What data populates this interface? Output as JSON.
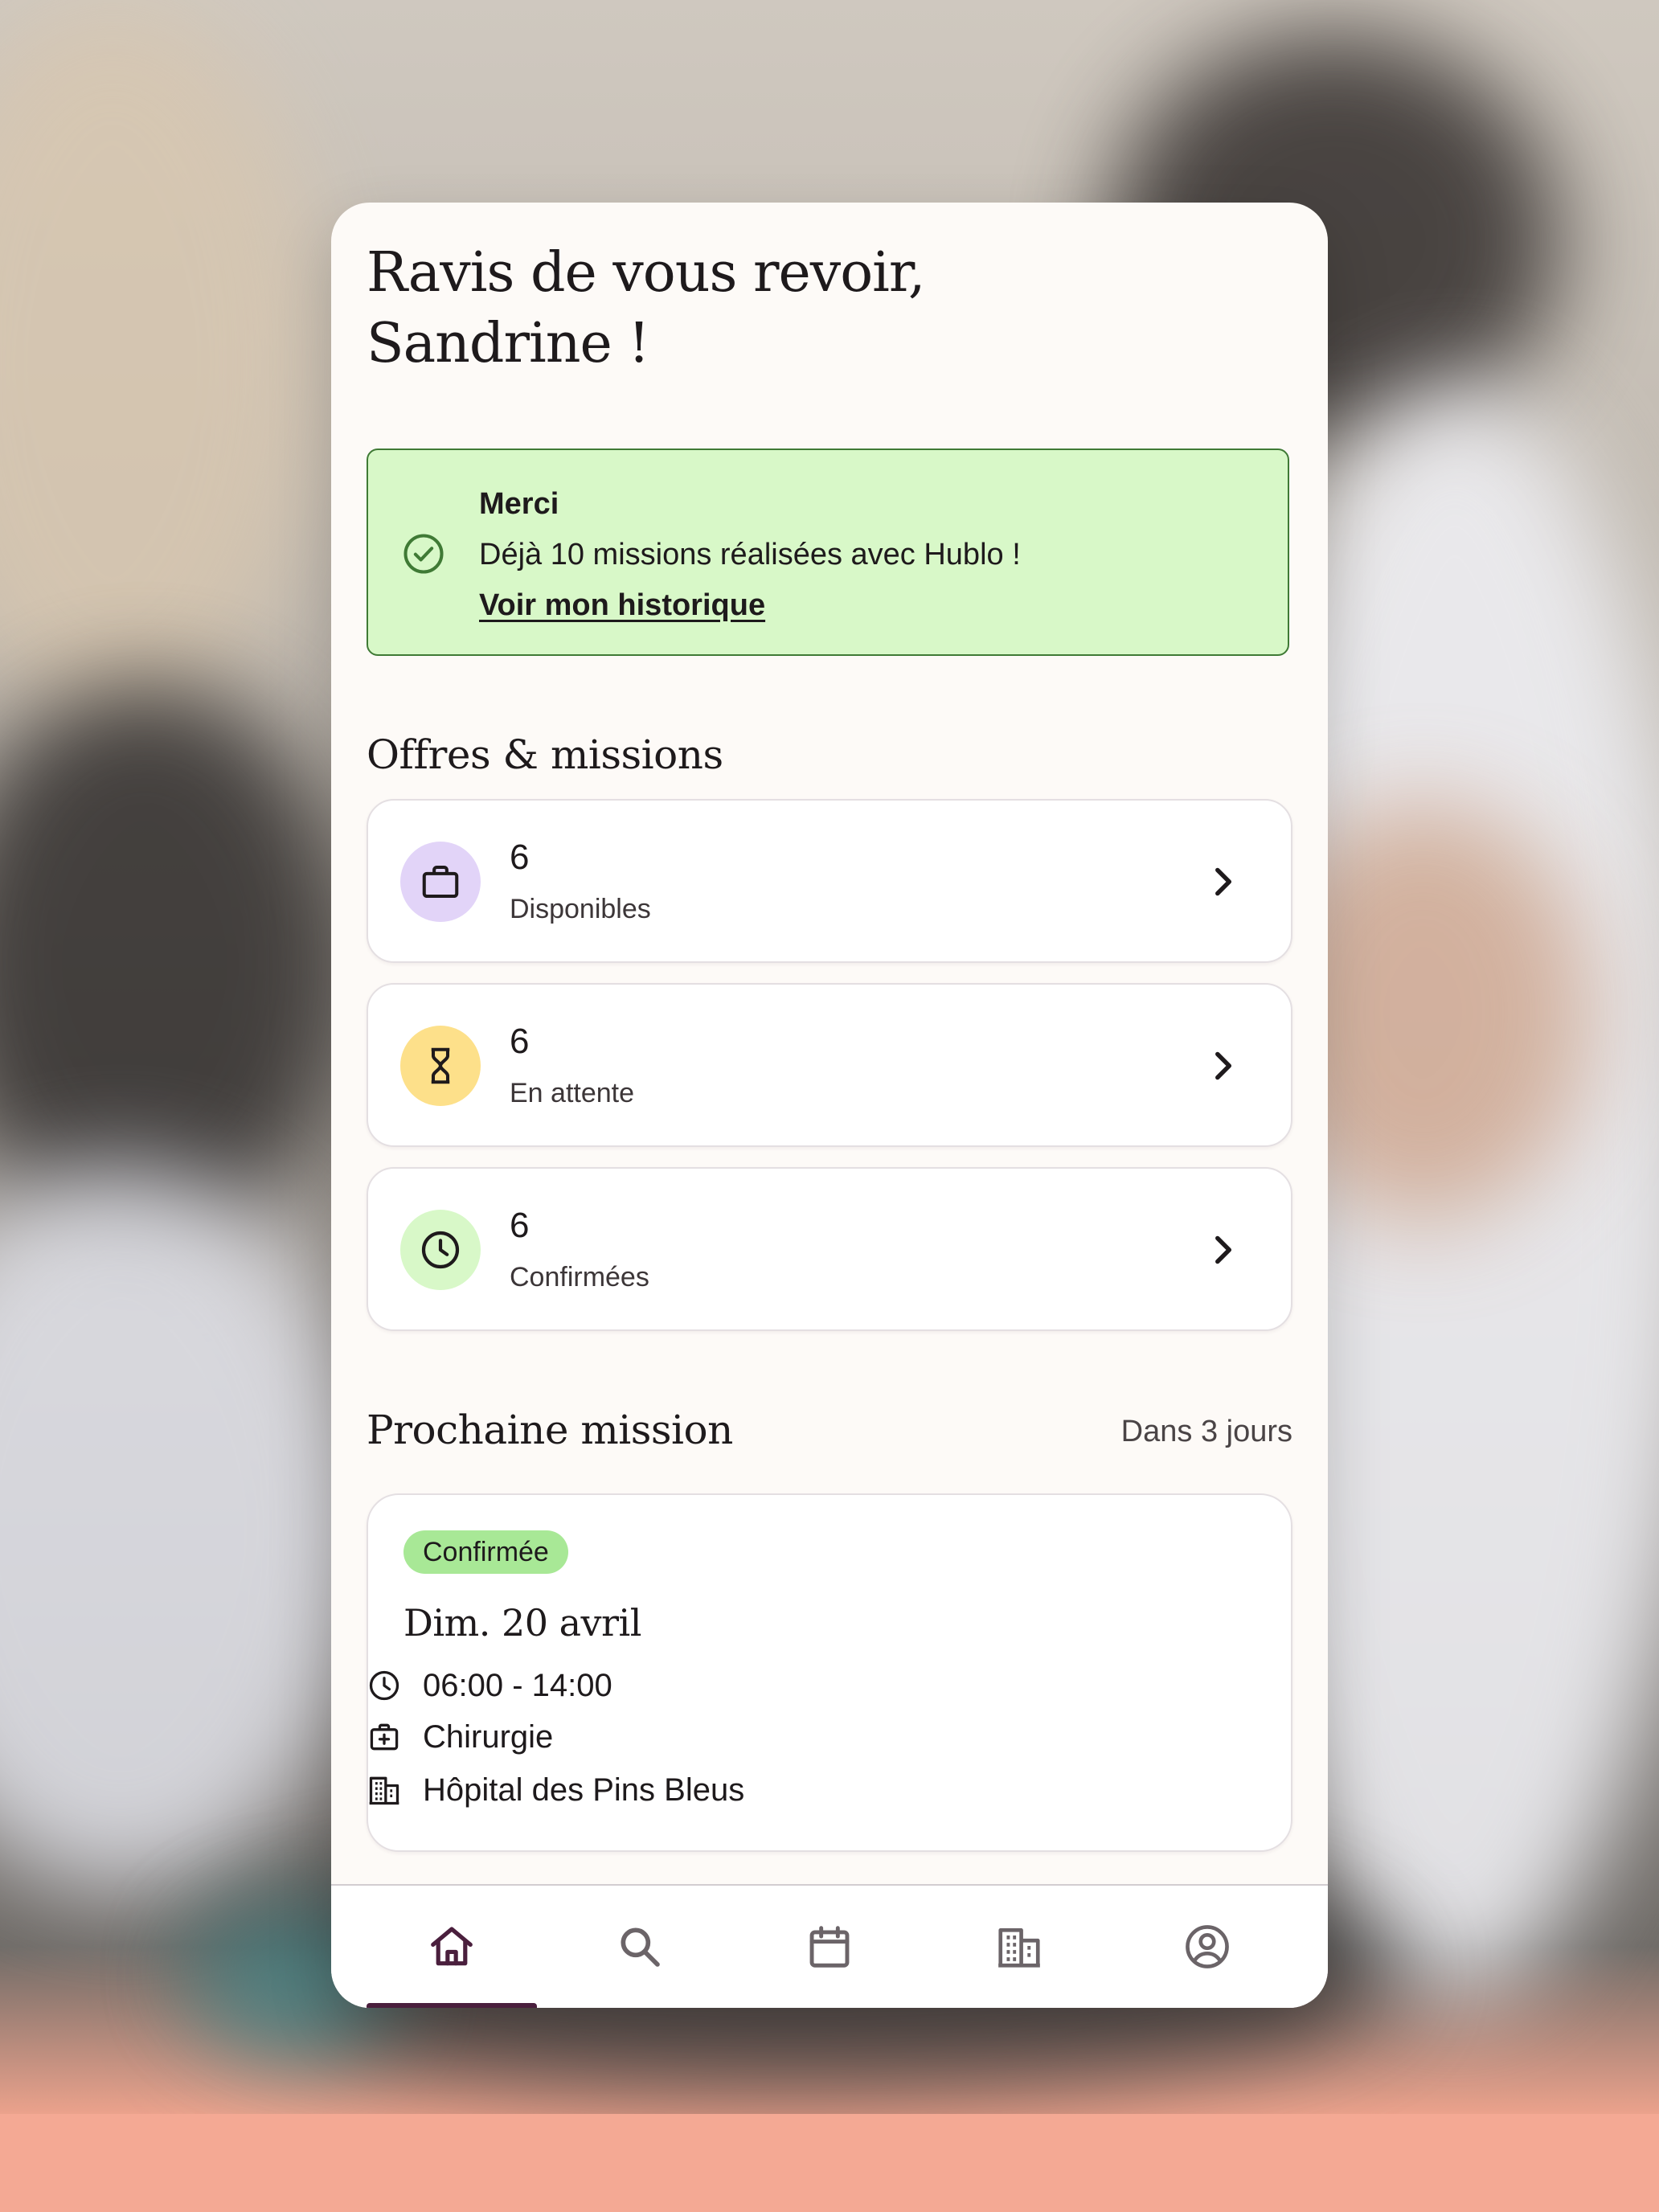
{
  "greeting": {
    "line1": "Ravis de vous revoir,",
    "line2": "Sandrine !"
  },
  "banner": {
    "title": "Merci",
    "message": "Déjà 10 missions réalisées avec Hublo !",
    "link_label": "Voir mon historique",
    "icon": "check-circle-icon",
    "background": "#d8f8c8",
    "border": "#3f7a35"
  },
  "offers": {
    "title": "Offres & missions",
    "cards": [
      {
        "count": "6",
        "label": "Disponibles",
        "icon": "briefcase-icon",
        "icon_bg": "#e2d4f8"
      },
      {
        "count": "6",
        "label": "En attente",
        "icon": "hourglass-icon",
        "icon_bg": "#fde08a"
      },
      {
        "count": "6",
        "label": "Confirmées",
        "icon": "clock-icon",
        "icon_bg": "#d8f8c8"
      }
    ]
  },
  "next_mission": {
    "title": "Prochaine mission",
    "when": "Dans 3 jours",
    "status": "Confirmée",
    "status_color": "#a8e896",
    "date": "Dim. 20 avril",
    "time": "06:00 - 14:00",
    "service": "Chirurgie",
    "place": "Hôpital des Pins Bleus"
  },
  "nav": {
    "items": [
      {
        "icon": "home-icon",
        "active": true
      },
      {
        "icon": "search-icon",
        "active": false
      },
      {
        "icon": "calendar-icon",
        "active": false
      },
      {
        "icon": "building-icon",
        "active": false
      },
      {
        "icon": "account-icon",
        "active": false
      }
    ],
    "active_color": "#4a1f3d",
    "inactive_color": "#6b6468"
  }
}
